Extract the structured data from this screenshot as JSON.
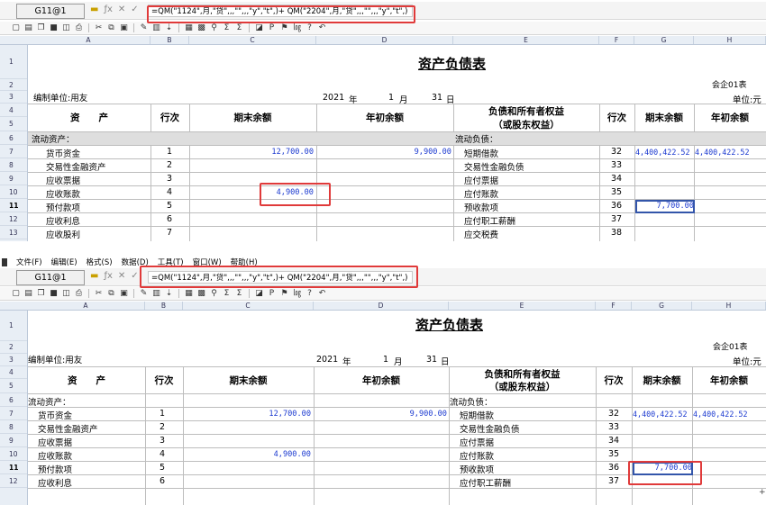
{
  "menubar": {
    "items": [
      "文件(F)",
      "编辑(E)",
      "格式(S)",
      "数据(D)",
      "工具(T)",
      "窗口(W)",
      "帮助(H)"
    ]
  },
  "formula_bar": {
    "top_cell_ref": "G11@1",
    "bottom_cell_ref": "G11@1",
    "formula": "=QM(\"1124\",月,\"贷\",,,\"\",,,\"y\",\"t\",)+ QM(\"2204\",月,\"贷\",,,\"\",,,\"y\",\"t\",)",
    "icons": [
      "confirm-icon",
      "function-icon",
      "cancel-icon",
      "accept-icon"
    ]
  },
  "toolbar": {
    "icons": [
      "new-file-icon",
      "open-folder-icon",
      "copy-doc-icon",
      "save-icon",
      "print-preview-icon",
      "print-icon",
      "cut-icon",
      "copy-icon",
      "paste-icon",
      "format-painter-icon",
      "chart-icon",
      "sort-icon",
      "table-icon",
      "grid-icon",
      "binoculars-icon",
      "sum-icon",
      "sum-col-icon",
      "chart-wizard-icon",
      "p-icon",
      "flag-icon",
      "log-icon",
      "help-icon",
      "undo-icon"
    ]
  },
  "columns": [
    "A",
    "B",
    "C",
    "D",
    "E",
    "F",
    "G",
    "H"
  ],
  "rows": [
    "1",
    "2",
    "3",
    "4",
    "5",
    "6",
    "7",
    "8",
    "9",
    "10",
    "11",
    "12",
    "13"
  ],
  "sheet": {
    "title": "资产负债表",
    "form_no": "会企01表",
    "company": "编制单位:用友",
    "unit": "单位:元",
    "year": "2021",
    "year_label": "年",
    "month": "1",
    "month_label": "月",
    "day": "31",
    "day_label": "日",
    "headers": {
      "asset": "资　　产",
      "line_no": "行次",
      "end_balance": "期末余额",
      "begin_balance": "年初余额",
      "liab_line1": "负债和所有者权益",
      "liab_line2": "（或股东权益）",
      "line_no_2": "行次",
      "end_balance_2": "期末余额",
      "begin_balance_2": "年初余额"
    },
    "section_left": "流动资产：",
    "section_right": "流动负债：",
    "left_rows": [
      {
        "name": "货币资金",
        "line": "1",
        "end": "12,700.00",
        "begin": "9,900.00"
      },
      {
        "name": "交易性金融资产",
        "line": "2",
        "end": "",
        "begin": ""
      },
      {
        "name": "应收票据",
        "line": "3",
        "end": "",
        "begin": ""
      },
      {
        "name": "应收账款",
        "line": "4",
        "end": "4,900.00",
        "begin": ""
      },
      {
        "name": "预付款项",
        "line": "5",
        "end": "",
        "begin": ""
      },
      {
        "name": "应收利息",
        "line": "6",
        "end": "",
        "begin": ""
      },
      {
        "name": "应收股利",
        "line": "7",
        "end": "",
        "begin": ""
      }
    ],
    "right_rows": [
      {
        "name": "短期借款",
        "line": "32",
        "end": "4,400,422.52",
        "begin": "4,400,422.52"
      },
      {
        "name": "交易性金融负债",
        "line": "33",
        "end": "",
        "begin": ""
      },
      {
        "name": "应付票据",
        "line": "34",
        "end": "",
        "begin": ""
      },
      {
        "name": "应付账款",
        "line": "35",
        "end": "",
        "begin": ""
      },
      {
        "name": "预收款项",
        "line": "36",
        "end": "7,700.00",
        "begin": ""
      },
      {
        "name": "应付职工薪酬",
        "line": "37",
        "end": "",
        "begin": ""
      },
      {
        "name": "应交税费",
        "line": "38",
        "end": "",
        "begin": ""
      }
    ]
  },
  "colors": {
    "highlight_border": "#e03a3a",
    "value_text": "#1d3bd0",
    "header_bg": "#e8eef5"
  }
}
